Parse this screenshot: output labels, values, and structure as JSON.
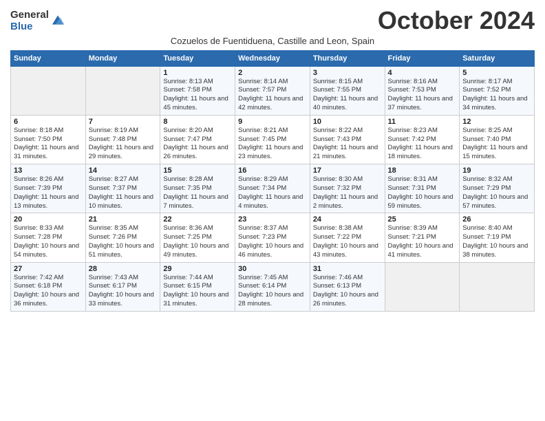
{
  "logo": {
    "general": "General",
    "blue": "Blue"
  },
  "header": {
    "title": "October 2024",
    "subtitle": "Cozuelos de Fuentiduena, Castille and Leon, Spain"
  },
  "days": [
    "Sunday",
    "Monday",
    "Tuesday",
    "Wednesday",
    "Thursday",
    "Friday",
    "Saturday"
  ],
  "weeks": [
    [
      {
        "num": "",
        "info": ""
      },
      {
        "num": "",
        "info": ""
      },
      {
        "num": "1",
        "info": "Sunrise: 8:13 AM\nSunset: 7:58 PM\nDaylight: 11 hours and 45 minutes."
      },
      {
        "num": "2",
        "info": "Sunrise: 8:14 AM\nSunset: 7:57 PM\nDaylight: 11 hours and 42 minutes."
      },
      {
        "num": "3",
        "info": "Sunrise: 8:15 AM\nSunset: 7:55 PM\nDaylight: 11 hours and 40 minutes."
      },
      {
        "num": "4",
        "info": "Sunrise: 8:16 AM\nSunset: 7:53 PM\nDaylight: 11 hours and 37 minutes."
      },
      {
        "num": "5",
        "info": "Sunrise: 8:17 AM\nSunset: 7:52 PM\nDaylight: 11 hours and 34 minutes."
      }
    ],
    [
      {
        "num": "6",
        "info": "Sunrise: 8:18 AM\nSunset: 7:50 PM\nDaylight: 11 hours and 31 minutes."
      },
      {
        "num": "7",
        "info": "Sunrise: 8:19 AM\nSunset: 7:48 PM\nDaylight: 11 hours and 29 minutes."
      },
      {
        "num": "8",
        "info": "Sunrise: 8:20 AM\nSunset: 7:47 PM\nDaylight: 11 hours and 26 minutes."
      },
      {
        "num": "9",
        "info": "Sunrise: 8:21 AM\nSunset: 7:45 PM\nDaylight: 11 hours and 23 minutes."
      },
      {
        "num": "10",
        "info": "Sunrise: 8:22 AM\nSunset: 7:43 PM\nDaylight: 11 hours and 21 minutes."
      },
      {
        "num": "11",
        "info": "Sunrise: 8:23 AM\nSunset: 7:42 PM\nDaylight: 11 hours and 18 minutes."
      },
      {
        "num": "12",
        "info": "Sunrise: 8:25 AM\nSunset: 7:40 PM\nDaylight: 11 hours and 15 minutes."
      }
    ],
    [
      {
        "num": "13",
        "info": "Sunrise: 8:26 AM\nSunset: 7:39 PM\nDaylight: 11 hours and 13 minutes."
      },
      {
        "num": "14",
        "info": "Sunrise: 8:27 AM\nSunset: 7:37 PM\nDaylight: 11 hours and 10 minutes."
      },
      {
        "num": "15",
        "info": "Sunrise: 8:28 AM\nSunset: 7:35 PM\nDaylight: 11 hours and 7 minutes."
      },
      {
        "num": "16",
        "info": "Sunrise: 8:29 AM\nSunset: 7:34 PM\nDaylight: 11 hours and 4 minutes."
      },
      {
        "num": "17",
        "info": "Sunrise: 8:30 AM\nSunset: 7:32 PM\nDaylight: 11 hours and 2 minutes."
      },
      {
        "num": "18",
        "info": "Sunrise: 8:31 AM\nSunset: 7:31 PM\nDaylight: 10 hours and 59 minutes."
      },
      {
        "num": "19",
        "info": "Sunrise: 8:32 AM\nSunset: 7:29 PM\nDaylight: 10 hours and 57 minutes."
      }
    ],
    [
      {
        "num": "20",
        "info": "Sunrise: 8:33 AM\nSunset: 7:28 PM\nDaylight: 10 hours and 54 minutes."
      },
      {
        "num": "21",
        "info": "Sunrise: 8:35 AM\nSunset: 7:26 PM\nDaylight: 10 hours and 51 minutes."
      },
      {
        "num": "22",
        "info": "Sunrise: 8:36 AM\nSunset: 7:25 PM\nDaylight: 10 hours and 49 minutes."
      },
      {
        "num": "23",
        "info": "Sunrise: 8:37 AM\nSunset: 7:23 PM\nDaylight: 10 hours and 46 minutes."
      },
      {
        "num": "24",
        "info": "Sunrise: 8:38 AM\nSunset: 7:22 PM\nDaylight: 10 hours and 43 minutes."
      },
      {
        "num": "25",
        "info": "Sunrise: 8:39 AM\nSunset: 7:21 PM\nDaylight: 10 hours and 41 minutes."
      },
      {
        "num": "26",
        "info": "Sunrise: 8:40 AM\nSunset: 7:19 PM\nDaylight: 10 hours and 38 minutes."
      }
    ],
    [
      {
        "num": "27",
        "info": "Sunrise: 7:42 AM\nSunset: 6:18 PM\nDaylight: 10 hours and 36 minutes."
      },
      {
        "num": "28",
        "info": "Sunrise: 7:43 AM\nSunset: 6:17 PM\nDaylight: 10 hours and 33 minutes."
      },
      {
        "num": "29",
        "info": "Sunrise: 7:44 AM\nSunset: 6:15 PM\nDaylight: 10 hours and 31 minutes."
      },
      {
        "num": "30",
        "info": "Sunrise: 7:45 AM\nSunset: 6:14 PM\nDaylight: 10 hours and 28 minutes."
      },
      {
        "num": "31",
        "info": "Sunrise: 7:46 AM\nSunset: 6:13 PM\nDaylight: 10 hours and 26 minutes."
      },
      {
        "num": "",
        "info": ""
      },
      {
        "num": "",
        "info": ""
      }
    ]
  ]
}
